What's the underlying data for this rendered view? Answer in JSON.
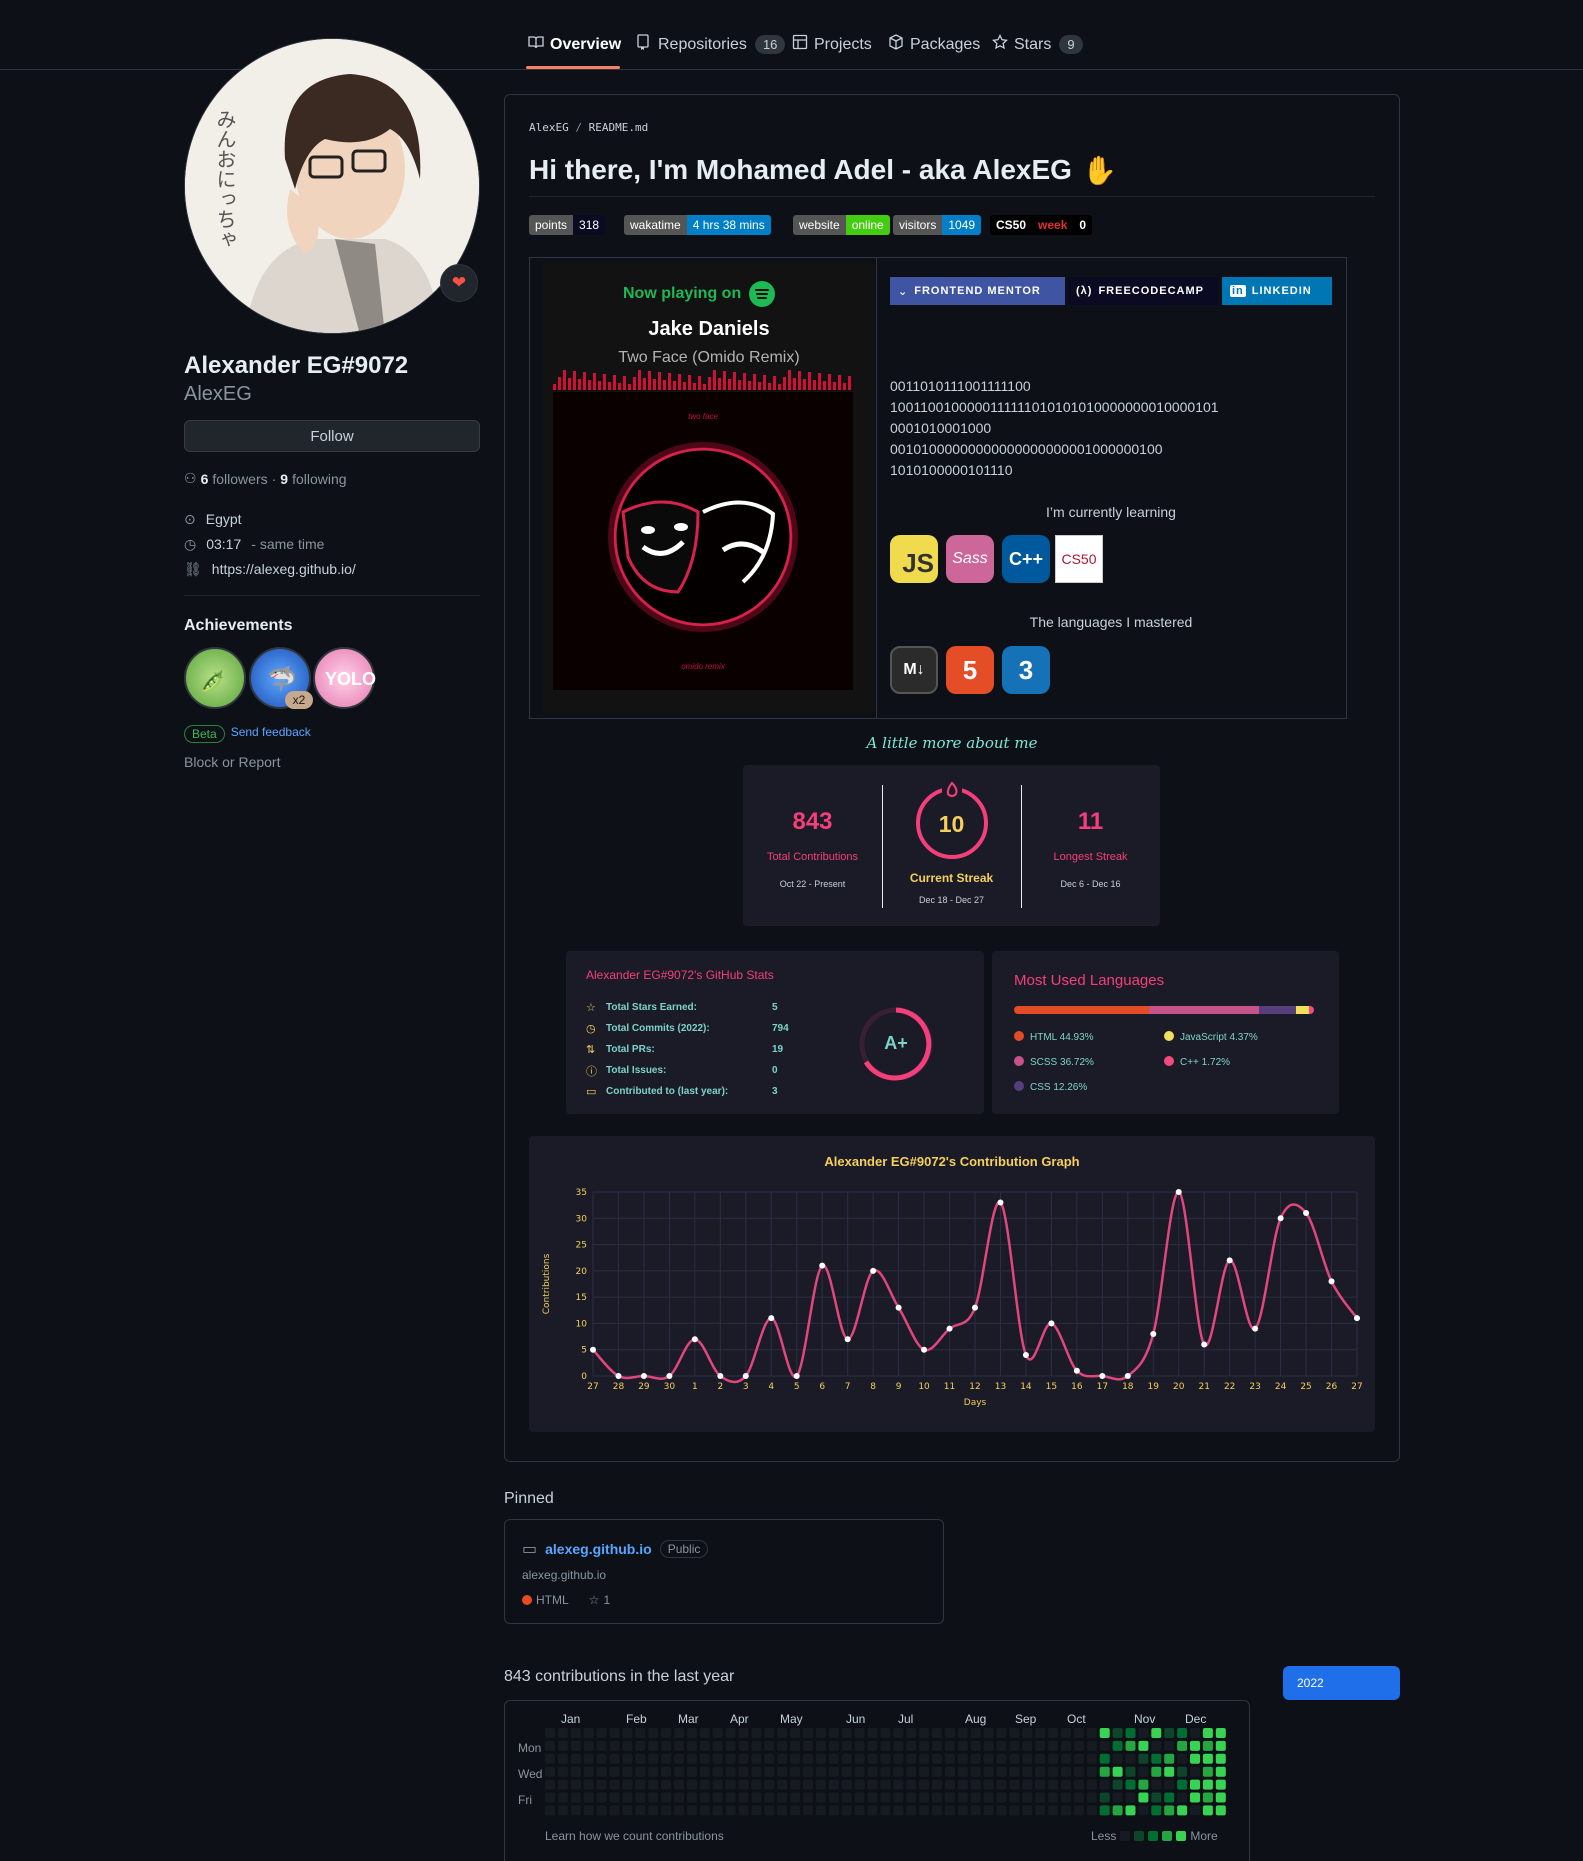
{
  "nav": {
    "tabs": [
      {
        "label": "Overview",
        "icon": "book-icon"
      },
      {
        "label": "Repositories",
        "count": "16",
        "icon": "repo-icon"
      },
      {
        "label": "Projects",
        "icon": "table-icon"
      },
      {
        "label": "Packages",
        "icon": "package-icon"
      },
      {
        "label": "Stars",
        "count": "9",
        "icon": "star-icon"
      }
    ]
  },
  "profile": {
    "name": "Alexander EG#9072",
    "username": "AlexEG",
    "follow_label": "Follow",
    "followers_count": "6",
    "followers_label": "followers",
    "following_count": "9",
    "following_label": "following",
    "location": "Egypt",
    "time": "03:17",
    "time_note": "- same time",
    "website": "https://alexeg.github.io/",
    "achievements_title": "Achievements",
    "achievement_multiplier": "x2",
    "beta_label": "Beta",
    "feedback_label": "Send feedback",
    "block_label": "Block or Report",
    "status_icon": "fire-heart-icon"
  },
  "readme": {
    "path_user": "AlexEG",
    "path_sep": "/",
    "path_file": "README.md",
    "title": "Hi there, I'm Mohamed Adel - aka AlexEG",
    "wave_icon": "waving-hand-icon",
    "badges": [
      {
        "label": "points",
        "value": "318",
        "value_color": "#0a0a23"
      },
      {
        "label": "wakatime",
        "value": "4 hrs 38 mins",
        "value_color": "#007ec6"
      },
      {
        "label": "website",
        "value": "online",
        "value_color": "#4c1"
      },
      {
        "label": "visitors",
        "value": "1049",
        "value_color": "#007ec6"
      },
      {
        "label": "CS50",
        "value": "week",
        "extra": "0",
        "value_color": "#000000"
      }
    ],
    "spotify": {
      "heading": "Now playing on",
      "artist": "Jake Daniels",
      "track": "Two Face (Omido Remix)",
      "cover_top": "two face",
      "cover_bottom": "omido remix"
    },
    "social": [
      {
        "label": "FRONTEND MENTOR",
        "color": "#3f54a3"
      },
      {
        "label": "FREECODECAMP",
        "color": "#0a0a23"
      },
      {
        "label": "LINKEDIN",
        "color": "#0077b5"
      }
    ],
    "binary": [
      "0011010111001111100",
      "1001100100000111111010101010000000010000101",
      "0001010001000",
      "00101000000000000000000001000000100",
      "1010100000101110"
    ],
    "learning_title": "I’m currently learning",
    "learning": [
      {
        "label": "JS",
        "color": "#f0db4f"
      },
      {
        "label": "Sass",
        "color": "#cd6799"
      },
      {
        "label": "C++",
        "color": "#00599c"
      },
      {
        "label": "CS50",
        "color": "#ffffff"
      }
    ],
    "mastered_title": "The languages I mastered",
    "mastered": [
      {
        "label": "M↓",
        "color": "#2b2b2b"
      },
      {
        "label": "5",
        "color": "#e44d26"
      },
      {
        "label": "3",
        "color": "#1572b6"
      }
    ],
    "about_title": "A little more about me",
    "streak": {
      "total": "843",
      "total_label": "Total Contributions",
      "total_range": "Oct 22 - Present",
      "current": "10",
      "current_label": "Current Streak",
      "current_range": "Dec 18 - Dec 27",
      "longest": "11",
      "longest_label": "Longest Streak",
      "longest_range": "Dec 6 - Dec 16"
    },
    "stats": {
      "title": "Alexander EG#9072's GitHub Stats",
      "grade": "A+",
      "rows": [
        {
          "label": "Total Stars Earned:",
          "value": "5",
          "icon": "star-icon"
        },
        {
          "label": "Total Commits (2022):",
          "value": "794",
          "icon": "history-icon"
        },
        {
          "label": "Total PRs:",
          "value": "19",
          "icon": "pull-request-icon"
        },
        {
          "label": "Total Issues:",
          "value": "0",
          "icon": "issue-icon"
        },
        {
          "label": "Contributed to (last year):",
          "value": "3",
          "icon": "repo-icon"
        }
      ]
    },
    "langs": {
      "title": "Most Used Languages",
      "items": [
        {
          "name": "HTML 44.93%",
          "color": "#e34c26",
          "pct": 44.93
        },
        {
          "name": "SCSS 36.72%",
          "color": "#c6538c",
          "pct": 36.72
        },
        {
          "name": "CSS 12.26%",
          "color": "#563d7c",
          "pct": 12.26
        },
        {
          "name": "JavaScript 4.37%",
          "color": "#f1e05a",
          "pct": 4.37
        },
        {
          "name": "C++ 1.72%",
          "color": "#f34b7d",
          "pct": 1.72
        }
      ]
    }
  },
  "chart_data": {
    "type": "line",
    "title": "Alexander EG#9072's Contribution Graph",
    "xlabel": "Days",
    "ylabel": "Contributions",
    "ylim": [
      0,
      35
    ],
    "yticks": [
      0,
      5,
      10,
      15,
      20,
      25,
      30,
      35
    ],
    "x": [
      "27",
      "28",
      "29",
      "30",
      "1",
      "2",
      "3",
      "4",
      "5",
      "6",
      "7",
      "8",
      "9",
      "10",
      "11",
      "12",
      "13",
      "14",
      "15",
      "16",
      "17",
      "18",
      "19",
      "20",
      "21",
      "22",
      "23",
      "24",
      "25",
      "26",
      "27"
    ],
    "series": [
      {
        "values": [
          5,
          0,
          0,
          0,
          7,
          0,
          0,
          11,
          0,
          21,
          7,
          20,
          13,
          5,
          9,
          13,
          33,
          4,
          10,
          1,
          0,
          0,
          8,
          35,
          6,
          22,
          9,
          30,
          31,
          18,
          11
        ]
      }
    ],
    "grid": true,
    "line_color": "#e1467c"
  },
  "pinned": {
    "title": "Pinned",
    "repo": "alexeg.github.io",
    "visibility": "Public",
    "desc": "alexeg.github.io",
    "lang": "HTML",
    "lang_color": "#e34c26",
    "stars": "1"
  },
  "contrib": {
    "title": "843 contributions in the last year",
    "year": "2022",
    "months": [
      "Jan",
      "Feb",
      "Mar",
      "Apr",
      "May",
      "Jun",
      "Jul",
      "Aug",
      "Sep",
      "Oct",
      "Nov",
      "Dec"
    ],
    "days": [
      "Mon",
      "Wed",
      "Fri"
    ],
    "learn": "Learn how we count contributions",
    "less": "Less",
    "more": "More"
  }
}
